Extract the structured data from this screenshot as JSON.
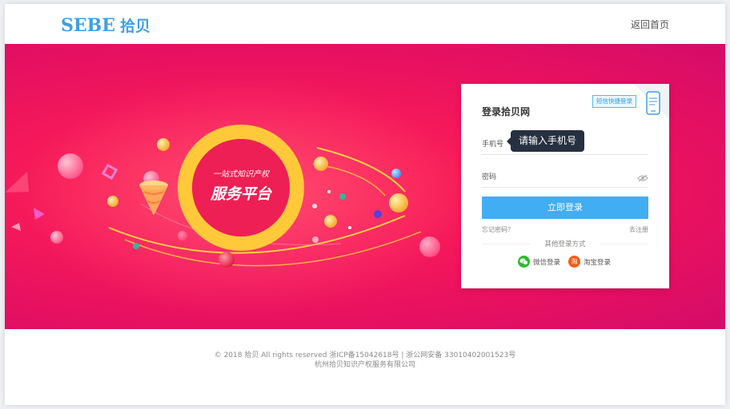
{
  "header": {
    "logo_en": "SEBE",
    "logo_cn": "拾贝",
    "home_link": "返回首页"
  },
  "banner": {
    "slogan_line1": "一站式知识产权",
    "slogan_line2": "服务平台"
  },
  "login": {
    "title": "登录拾贝网",
    "sms_tag": "短信快捷登录",
    "phone_label": "手机号",
    "phone_tooltip": "请输入手机号",
    "password_label": "密码",
    "submit_label": "立即登录",
    "forgot_label": "忘记密码？",
    "register_label": "去注册",
    "other_title": "其他登录方式",
    "wechat_label": "微信登录",
    "taobao_label": "淘宝登录",
    "taobao_glyph": "淘"
  },
  "footer": {
    "line1": "© 2018 拾贝 All rights reserved 浙ICP备15042618号 | 浙公网安备 33010402001523号",
    "line2": "杭州拾贝知识产权服务有限公司"
  },
  "colors": {
    "accent": "#3ba0e9",
    "button": "#41adf3",
    "banner": "#f0165c",
    "wechat": "#2dbb2d",
    "taobao": "#f25c14"
  },
  "icons": [
    "phone-icon",
    "eye-slash-icon",
    "wechat-icon",
    "taobao-icon"
  ]
}
